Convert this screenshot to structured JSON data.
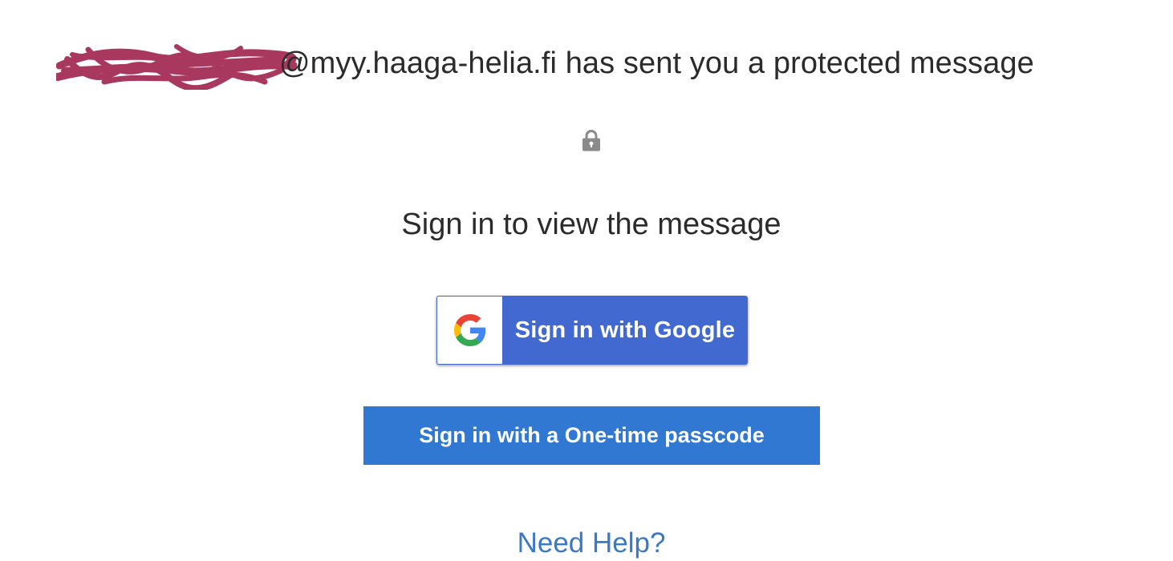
{
  "header": {
    "message_text": "@myy.haaga-helia.fi has sent you a protected message",
    "redaction_color": "#a8385e"
  },
  "lock": {
    "icon": "lock-icon",
    "color": "#8a8a8a"
  },
  "prompt": {
    "title": "Sign in to view the message"
  },
  "google_button": {
    "label": "Sign in with Google",
    "icon": "google-g-icon",
    "background": "#4169cf"
  },
  "otp_button": {
    "label": "Sign in with a One-time passcode",
    "background": "#3078d1"
  },
  "help": {
    "label": "Need Help?",
    "color": "#3c78c4"
  }
}
